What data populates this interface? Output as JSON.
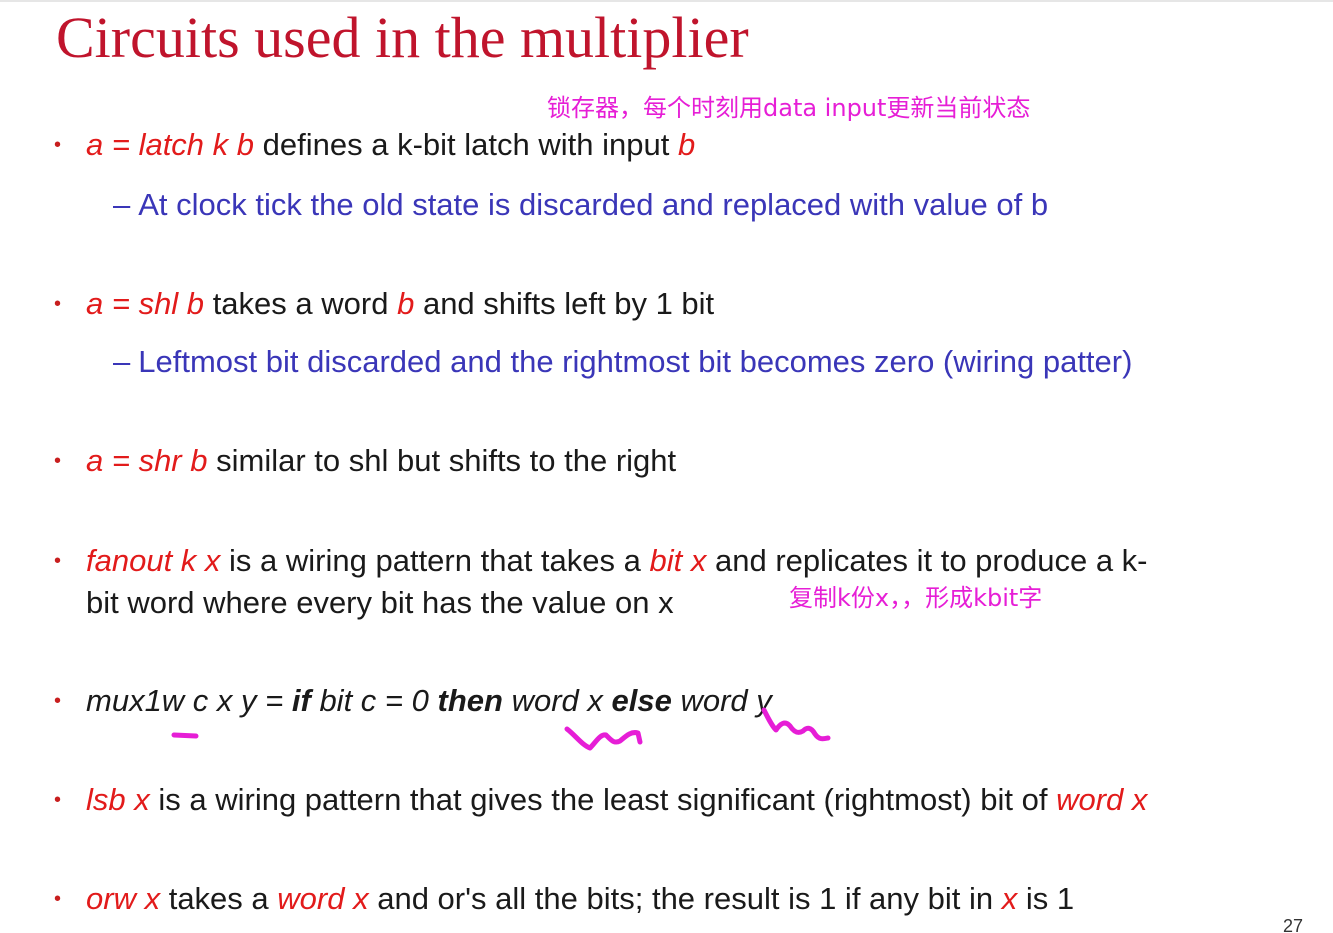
{
  "title": "Circuits used in the multiplier",
  "annotations": {
    "latch_note": "锁存器，每个时刻用data input更新当前状态",
    "fanout_note": "复制k份x，，形成kbit字"
  },
  "bullets": {
    "latch": {
      "expr": "a = latch k b",
      "text": "defines a k-bit latch with input",
      "arg": "b",
      "sub": "At clock tick the old state is discarded and replaced with value of b"
    },
    "shl": {
      "expr": "a = shl b",
      "t1": "takes a word",
      "arg": "b",
      "t2": "and shifts left by 1 bit",
      "sub": "Leftmost bit discarded and the rightmost bit becomes zero (wiring patter)"
    },
    "shr": {
      "expr": "a = shr b",
      "text": "similar to shl but shifts to the right"
    },
    "fanout": {
      "expr": "fanout k x",
      "t1": "is a wiring pattern that takes a",
      "arg": "bit x",
      "t2": "and replicates it to produce a k-",
      "line2": "bit word where every bit has the value on x"
    },
    "mux": {
      "p1": "mux1w c x y =",
      "if": "if",
      "p2": "bit c = 0",
      "then": "then",
      "p3": "word x",
      "else": "else",
      "p4": "word y"
    },
    "lsb": {
      "expr": "lsb x",
      "text": "is a wiring pattern that gives the least significant (rightmost) bit of",
      "arg": "word x"
    },
    "orw": {
      "expr": "orw x",
      "t1": "takes a",
      "arg": "word x",
      "t2": "and or's all the bits; the result is 1 if any bit in",
      "arg2": "x",
      "t3": "is 1"
    }
  },
  "bullet_symbol": "•",
  "dash_symbol": "–",
  "page_number": "27",
  "colors": {
    "title": "#c0142c",
    "expression_red": "#e21b1b",
    "subpoint_blue": "#3a36b8",
    "annotation_magenta": "#e61ed6"
  }
}
